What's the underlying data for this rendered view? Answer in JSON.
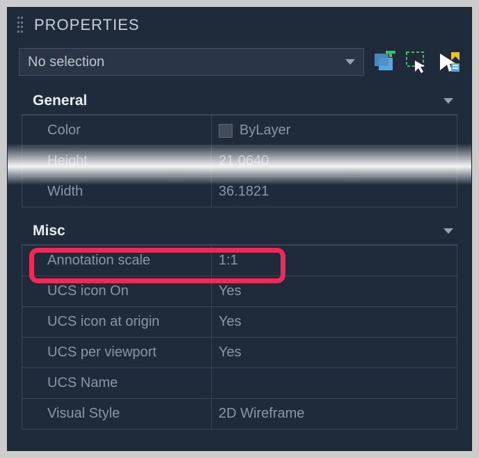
{
  "header": {
    "title": "PROPERTIES"
  },
  "selector": {
    "value": "No selection"
  },
  "sections": {
    "general": {
      "title": "General",
      "rows": {
        "color": {
          "label": "Color",
          "value": "ByLayer"
        },
        "height": {
          "label": "Height",
          "value": "21.0640"
        },
        "width": {
          "label": "Width",
          "value": "36.1821"
        }
      }
    },
    "misc": {
      "title": "Misc",
      "rows": {
        "annotation_scale": {
          "label": "Annotation scale",
          "value": "1:1"
        },
        "ucs_icon_on": {
          "label": "UCS icon On",
          "value": "Yes"
        },
        "ucs_icon_origin": {
          "label": "UCS icon at origin",
          "value": "Yes"
        },
        "ucs_per_viewport": {
          "label": "UCS per viewport",
          "value": "Yes"
        },
        "ucs_name": {
          "label": "UCS Name",
          "value": ""
        },
        "visual_style": {
          "label": "Visual Style",
          "value": "2D Wireframe"
        }
      }
    }
  }
}
